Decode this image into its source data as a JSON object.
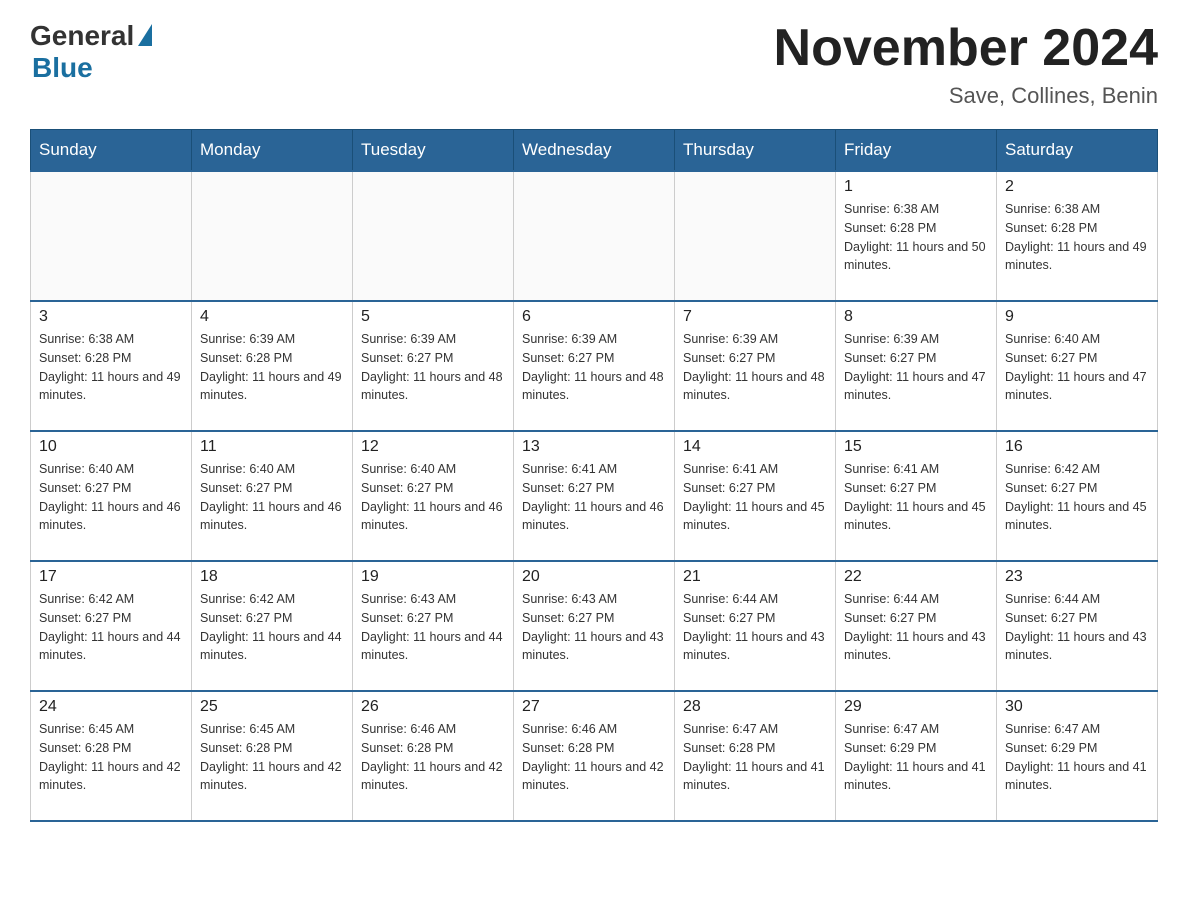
{
  "header": {
    "logo_text": "General",
    "logo_blue": "Blue",
    "month": "November 2024",
    "location": "Save, Collines, Benin"
  },
  "weekdays": [
    "Sunday",
    "Monday",
    "Tuesday",
    "Wednesday",
    "Thursday",
    "Friday",
    "Saturday"
  ],
  "weeks": [
    [
      {
        "day": "",
        "info": ""
      },
      {
        "day": "",
        "info": ""
      },
      {
        "day": "",
        "info": ""
      },
      {
        "day": "",
        "info": ""
      },
      {
        "day": "",
        "info": ""
      },
      {
        "day": "1",
        "info": "Sunrise: 6:38 AM\nSunset: 6:28 PM\nDaylight: 11 hours and 50 minutes."
      },
      {
        "day": "2",
        "info": "Sunrise: 6:38 AM\nSunset: 6:28 PM\nDaylight: 11 hours and 49 minutes."
      }
    ],
    [
      {
        "day": "3",
        "info": "Sunrise: 6:38 AM\nSunset: 6:28 PM\nDaylight: 11 hours and 49 minutes."
      },
      {
        "day": "4",
        "info": "Sunrise: 6:39 AM\nSunset: 6:28 PM\nDaylight: 11 hours and 49 minutes."
      },
      {
        "day": "5",
        "info": "Sunrise: 6:39 AM\nSunset: 6:27 PM\nDaylight: 11 hours and 48 minutes."
      },
      {
        "day": "6",
        "info": "Sunrise: 6:39 AM\nSunset: 6:27 PM\nDaylight: 11 hours and 48 minutes."
      },
      {
        "day": "7",
        "info": "Sunrise: 6:39 AM\nSunset: 6:27 PM\nDaylight: 11 hours and 48 minutes."
      },
      {
        "day": "8",
        "info": "Sunrise: 6:39 AM\nSunset: 6:27 PM\nDaylight: 11 hours and 47 minutes."
      },
      {
        "day": "9",
        "info": "Sunrise: 6:40 AM\nSunset: 6:27 PM\nDaylight: 11 hours and 47 minutes."
      }
    ],
    [
      {
        "day": "10",
        "info": "Sunrise: 6:40 AM\nSunset: 6:27 PM\nDaylight: 11 hours and 46 minutes."
      },
      {
        "day": "11",
        "info": "Sunrise: 6:40 AM\nSunset: 6:27 PM\nDaylight: 11 hours and 46 minutes."
      },
      {
        "day": "12",
        "info": "Sunrise: 6:40 AM\nSunset: 6:27 PM\nDaylight: 11 hours and 46 minutes."
      },
      {
        "day": "13",
        "info": "Sunrise: 6:41 AM\nSunset: 6:27 PM\nDaylight: 11 hours and 46 minutes."
      },
      {
        "day": "14",
        "info": "Sunrise: 6:41 AM\nSunset: 6:27 PM\nDaylight: 11 hours and 45 minutes."
      },
      {
        "day": "15",
        "info": "Sunrise: 6:41 AM\nSunset: 6:27 PM\nDaylight: 11 hours and 45 minutes."
      },
      {
        "day": "16",
        "info": "Sunrise: 6:42 AM\nSunset: 6:27 PM\nDaylight: 11 hours and 45 minutes."
      }
    ],
    [
      {
        "day": "17",
        "info": "Sunrise: 6:42 AM\nSunset: 6:27 PM\nDaylight: 11 hours and 44 minutes."
      },
      {
        "day": "18",
        "info": "Sunrise: 6:42 AM\nSunset: 6:27 PM\nDaylight: 11 hours and 44 minutes."
      },
      {
        "day": "19",
        "info": "Sunrise: 6:43 AM\nSunset: 6:27 PM\nDaylight: 11 hours and 44 minutes."
      },
      {
        "day": "20",
        "info": "Sunrise: 6:43 AM\nSunset: 6:27 PM\nDaylight: 11 hours and 43 minutes."
      },
      {
        "day": "21",
        "info": "Sunrise: 6:44 AM\nSunset: 6:27 PM\nDaylight: 11 hours and 43 minutes."
      },
      {
        "day": "22",
        "info": "Sunrise: 6:44 AM\nSunset: 6:27 PM\nDaylight: 11 hours and 43 minutes."
      },
      {
        "day": "23",
        "info": "Sunrise: 6:44 AM\nSunset: 6:27 PM\nDaylight: 11 hours and 43 minutes."
      }
    ],
    [
      {
        "day": "24",
        "info": "Sunrise: 6:45 AM\nSunset: 6:28 PM\nDaylight: 11 hours and 42 minutes."
      },
      {
        "day": "25",
        "info": "Sunrise: 6:45 AM\nSunset: 6:28 PM\nDaylight: 11 hours and 42 minutes."
      },
      {
        "day": "26",
        "info": "Sunrise: 6:46 AM\nSunset: 6:28 PM\nDaylight: 11 hours and 42 minutes."
      },
      {
        "day": "27",
        "info": "Sunrise: 6:46 AM\nSunset: 6:28 PM\nDaylight: 11 hours and 42 minutes."
      },
      {
        "day": "28",
        "info": "Sunrise: 6:47 AM\nSunset: 6:28 PM\nDaylight: 11 hours and 41 minutes."
      },
      {
        "day": "29",
        "info": "Sunrise: 6:47 AM\nSunset: 6:29 PM\nDaylight: 11 hours and 41 minutes."
      },
      {
        "day": "30",
        "info": "Sunrise: 6:47 AM\nSunset: 6:29 PM\nDaylight: 11 hours and 41 minutes."
      }
    ]
  ]
}
